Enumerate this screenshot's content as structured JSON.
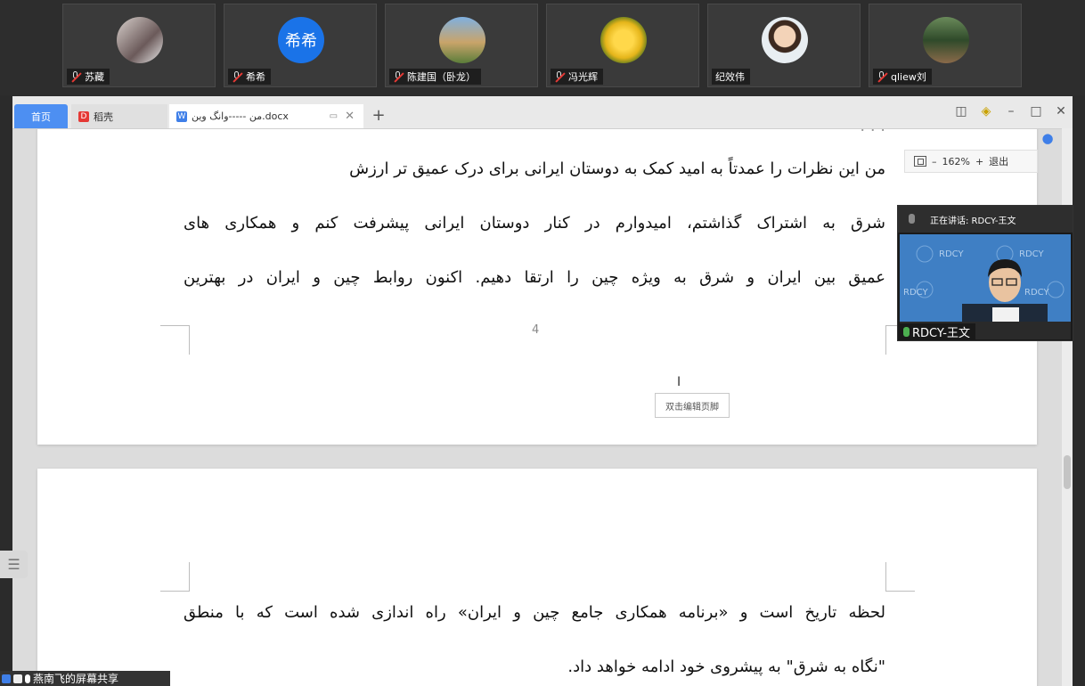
{
  "participants": [
    {
      "name": "苏藏",
      "muted": true,
      "avatar": "photo"
    },
    {
      "name": "希希",
      "muted": true,
      "avatar": "希希"
    },
    {
      "name": "陈建国（卧龙）",
      "muted": true,
      "avatar": "photo"
    },
    {
      "name": "冯光辉",
      "muted": true,
      "avatar": "photo"
    },
    {
      "name": "纪效伟",
      "muted": false,
      "avatar": "photo"
    },
    {
      "name": "qliew刘",
      "muted": true,
      "avatar": "photo"
    }
  ],
  "tabs": {
    "home": "首页",
    "daoke": "稻壳",
    "doc": "من -----وانگ وین.docx"
  },
  "zoom": {
    "minus": "–",
    "level": "162%",
    "plus": "+",
    "exit": "退出"
  },
  "document": {
    "page1_lines": [
      "من این نظرات را عمدتاً به امید کمک به دوستان ایرانی برای درک عمیق تر ارزش",
      "شرق به اشتراک گذاشتم، امیدوارم در کنار دوستان ایرانی پیشرفت کنم و همکاری های",
      "عمیق بین ایران و شرق به ویژه چین را ارتقا دهیم. اکنون روابط چین و ایران در بهترین"
    ],
    "page_number": "4",
    "footer_hint": "双击编辑页脚",
    "page2_lines": [
      "لحظه تاریخ است و «برنامه همکاری جامع چین و ایران» راه اندازی شده است که با منطق",
      "\"نگاه به شرق\" به پیشروی خود ادامه خواهد داد."
    ]
  },
  "speaker": {
    "status": "正在讲话: RDCY-王文",
    "name": "RDCY-王文"
  },
  "share_bar": {
    "label": "燕南飞的屏幕共享"
  },
  "colors": {
    "accent": "#4d8ff2",
    "danger": "#e53935",
    "mic_active": "#4caf50"
  }
}
